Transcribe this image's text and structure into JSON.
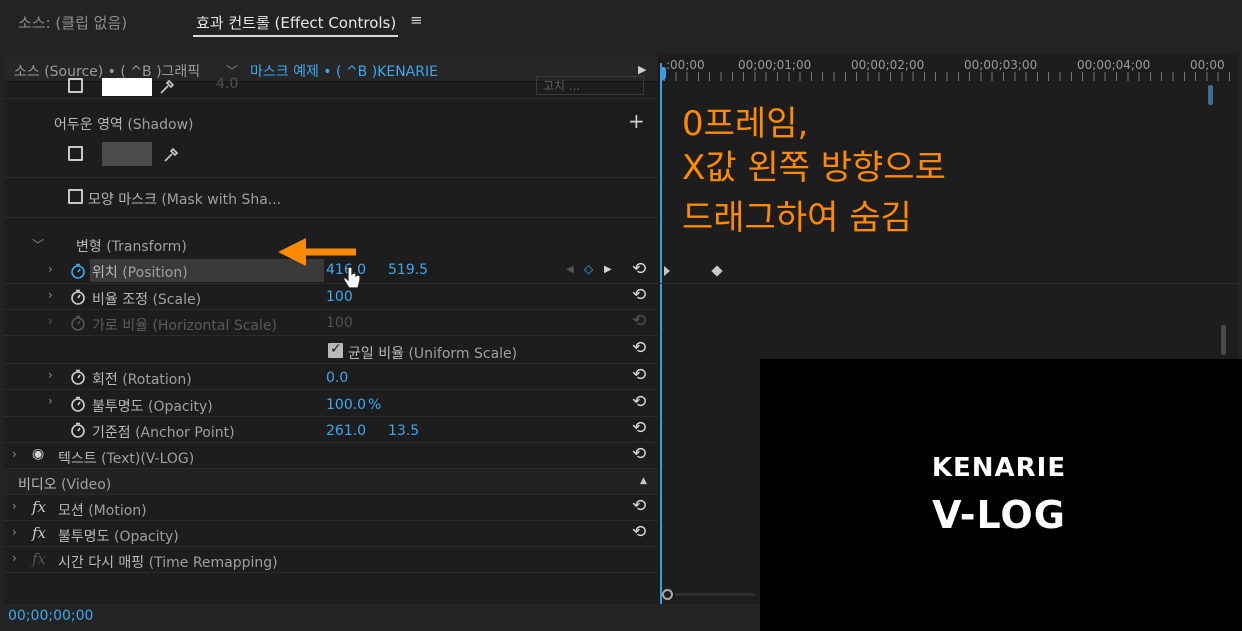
{
  "tabs": [
    {
      "label": "소스: (클립 없음)"
    },
    {
      "label": "효과 컨트롤 (Effect Controls)"
    }
  ],
  "header": {
    "source_label": "소스 (Source) • ( ^B )그래픽",
    "clip_label": "마스크 예제 • ( ^B )KENARIE"
  },
  "ruler": {
    "labels": [
      ":00;00",
      "00;00;01;00",
      "00;00;02;00",
      "00;00;03;00",
      "00;00;04;00",
      "00;00"
    ]
  },
  "rows": {
    "top_partial_value": "4.0",
    "top_partial_btn": "고치 ...",
    "shadow_label": "어두운 영역",
    "shadow_en": "(Shadow)",
    "mask_with_shape_label": "모양 마스크",
    "mask_with_shape_en": "(Mask with Sha...",
    "transform_label": "변형",
    "transform_en": "(Transform)",
    "position_label": "위치",
    "position_en": "(Position)",
    "position_x": "416.0",
    "position_y": "519.5",
    "scale_label": "비율 조정",
    "scale_en": "(Scale)",
    "scale_value": "100",
    "hscale_label": "가로 비율",
    "hscale_en": "(Horizontal Scale)",
    "hscale_value": "100",
    "uniform_label": "균일 비율",
    "uniform_en": "(Uniform Scale)",
    "rotation_label": "회전",
    "rotation_en": "(Rotation)",
    "rotation_value": "0.0",
    "opacity_label": "불투명도",
    "opacity_en": "(Opacity)",
    "opacity_value": "100.0",
    "opacity_unit": "%",
    "anchor_label": "기준점",
    "anchor_en": "(Anchor Point)",
    "anchor_x": "261.0",
    "anchor_y": "13.5",
    "text_label": "텍스트",
    "text_en": "(Text)(V-LOG)",
    "video_label": "비디오",
    "video_en": "(Video)",
    "motion_label": "모션",
    "motion_en": "(Motion)",
    "opacity2_label": "불투명도",
    "opacity2_en": "(Opacity)",
    "time_remap_label": "시간 다시 매핑",
    "time_remap_en": "(Time Remapping)"
  },
  "annotation": {
    "line1": "0프레임,",
    "line2": "X값 왼쪽 방향으로",
    "line3": "드래그하여 숨김"
  },
  "preview": {
    "line1": "KENARIE",
    "line2": "V-LOG"
  },
  "timecode": "00;00;00;00",
  "colors": {
    "accent": "#3ca8f0",
    "annotation": "#ff8a00",
    "background": "#1d1d1d"
  }
}
